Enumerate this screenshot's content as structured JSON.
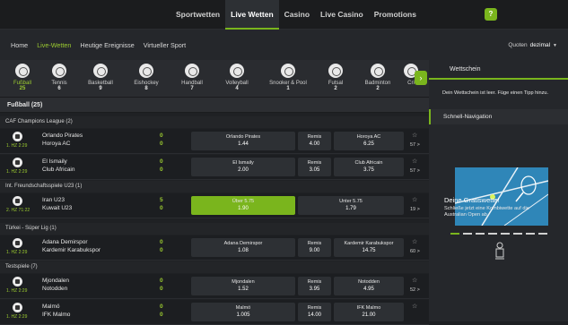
{
  "topnav": {
    "items": [
      "Sportwetten",
      "Live Wetten",
      "Casino",
      "Live Casino",
      "Promotions"
    ],
    "active": "Live Wetten",
    "help_icon": "?"
  },
  "subnav": {
    "items": [
      "Home",
      "Live-Wetten",
      "Heutige Ereignisse",
      "Virtueller Sport"
    ],
    "odds_label": "Quoten",
    "odds_value": "dezimal"
  },
  "sports": [
    {
      "name": "Fußball",
      "count": "25",
      "icon": "football-icon"
    },
    {
      "name": "Tennis",
      "count": "6",
      "icon": "tennis-icon"
    },
    {
      "name": "Basketball",
      "count": "9",
      "icon": "basketball-icon"
    },
    {
      "name": "Eishockey",
      "count": "8",
      "icon": "hockey-icon"
    },
    {
      "name": "Handball",
      "count": "7",
      "icon": "handball-icon"
    },
    {
      "name": "Volleyball",
      "count": "4",
      "icon": "volleyball-icon"
    },
    {
      "name": "Snooker & Pool",
      "count": "1",
      "icon": "snooker-icon"
    },
    {
      "name": "Futsal",
      "count": "2",
      "icon": "futsal-icon"
    },
    {
      "name": "Badminton",
      "count": "2",
      "icon": "badminton-icon"
    },
    {
      "name": "Cri",
      "count": "",
      "icon": "cricket-icon"
    }
  ],
  "category": "Fußball (25)",
  "leagues": [
    {
      "name": "CAF Champions League (2)"
    },
    {
      "name": "Int. Freundschaftsspiele U23 (1)"
    },
    {
      "name": "Türkei - Süper Lig (1)"
    },
    {
      "name": "Testspiele (7)"
    }
  ],
  "matches": [
    {
      "time": "1. HZ 2:29",
      "team1": "Orlando Pirates",
      "team2": "Horoya AC",
      "score1": "0",
      "score2": "0",
      "odds": [
        {
          "label": "Orlando Pirates",
          "value": "1.44"
        },
        {
          "label": "Remis",
          "value": "4.00"
        },
        {
          "label": "Horoya AC",
          "value": "6.25"
        }
      ],
      "more": "57 >"
    },
    {
      "time": "1. HZ 2:29",
      "team1": "El Ismaily",
      "team2": "Club Africain",
      "score1": "0",
      "score2": "0",
      "odds": [
        {
          "label": "El Ismaily",
          "value": "2.00"
        },
        {
          "label": "Remis",
          "value": "3.05"
        },
        {
          "label": "Club Africain",
          "value": "3.75"
        }
      ],
      "more": "57 >"
    },
    {
      "time": "2. HZ 71:22",
      "team1": "Iran U23",
      "team2": "Kuwait U23",
      "score1": "5",
      "score2": "0",
      "odds": [
        {
          "label": "Über 5.75",
          "value": "1.90"
        },
        {
          "label": "Unter 5.75",
          "value": "1.79"
        }
      ],
      "more": "19 >"
    },
    {
      "time": "1. HZ 2:29",
      "team1": "Adana Demirspor",
      "team2": "Kardemir Karabukspor",
      "score1": "0",
      "score2": "0",
      "odds": [
        {
          "label": "Adana Demirspor",
          "value": "1.08"
        },
        {
          "label": "Remis",
          "value": "9.00"
        },
        {
          "label": "Kardemir Karabukspor",
          "value": "14.75"
        }
      ],
      "more": "60 >"
    },
    {
      "time": "1. HZ 2:29",
      "team1": "Mjondalen",
      "team2": "Notodden",
      "score1": "0",
      "score2": "0",
      "odds": [
        {
          "label": "Mjondalen",
          "value": "1.52"
        },
        {
          "label": "Remis",
          "value": "3.95"
        },
        {
          "label": "Notodden",
          "value": "4.95"
        }
      ],
      "more": "52 >"
    },
    {
      "time": "1. HZ 2:29",
      "team1": "Malmö",
      "team2": "IFK Malmo",
      "score1": "0",
      "score2": "0",
      "odds": [
        {
          "label": "Malmö",
          "value": "1.005"
        },
        {
          "label": "Remis",
          "value": "14.00"
        },
        {
          "label": "IFK Malmo",
          "value": "21.00"
        }
      ],
      "more": ""
    }
  ],
  "betslip": {
    "tab": "Wettschein",
    "empty_text": "Dein Wettschein ist leer. Füge einen Tipp hinzu."
  },
  "quicknav": {
    "title": "Schnell-Navigation"
  },
  "promo": {
    "title": "Deine Gratiswette!",
    "text": "Schließe jetzt eine Kombiwette auf die Australian Open ab."
  },
  "colors": {
    "accent": "#7ab51d",
    "accent_text": "#9ccc30",
    "bg": "#1d1f22"
  }
}
